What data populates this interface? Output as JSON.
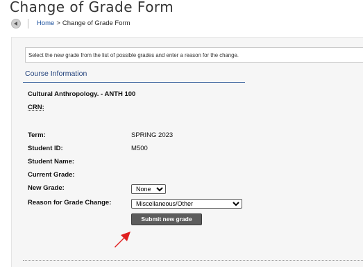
{
  "page": {
    "title": "Change of Grade Form"
  },
  "breadcrumb": {
    "home": "Home",
    "separator": ">",
    "current": "Change of Grade Form"
  },
  "instructions": "Select the new grade from the list of possible grades and enter a reason for the change.",
  "section": {
    "title": "Course Information"
  },
  "course": {
    "title": "Cultural Anthropology. - ANTH 100",
    "crn_label": "CRN:"
  },
  "fields": {
    "term": {
      "label": "Term:",
      "value": "SPRING 2023"
    },
    "student_id": {
      "label": "Student ID:",
      "value": "M500"
    },
    "student_name": {
      "label": "Student Name:",
      "value": ""
    },
    "current_grade": {
      "label": "Current Grade:",
      "value": ""
    },
    "new_grade": {
      "label": "New Grade:",
      "selected": "None"
    },
    "reason": {
      "label": "Reason for Grade Change:",
      "selected": "Miscellaneous/Other"
    }
  },
  "submit": {
    "label": "Submit new grade"
  },
  "icons": {
    "back": "back-arrow-icon",
    "pointer": "red-arrow-icon"
  },
  "colors": {
    "link": "#1a4f9c",
    "section_title": "#1f3f7a",
    "button": "#5c5c5c",
    "arrow": "#e02020"
  }
}
